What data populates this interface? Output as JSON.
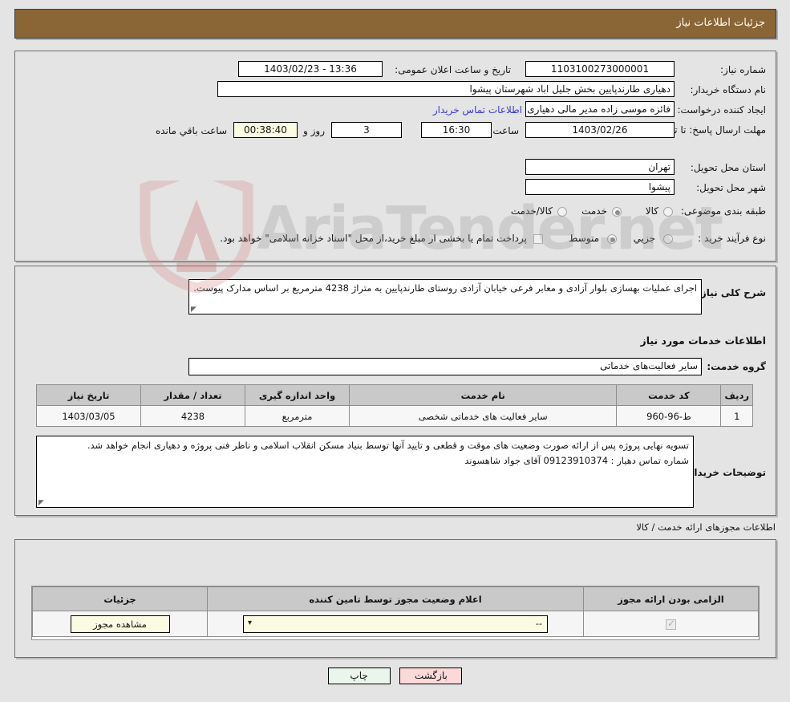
{
  "header": {
    "title": "جزئیات اطلاعات نیاز"
  },
  "form": {
    "need_number_label": "شماره نیاز:",
    "need_number_value": "1103100273000001",
    "announce_datetime_label": "تاریخ و ساعت اعلان عمومی:",
    "announce_datetime_value": "13:36 - 1403/02/23",
    "buyer_org_label": "نام دستگاه خریدار:",
    "buyer_org_value": "دهیاری طارندپایین بخش جلیل اباد شهرستان پیشوا",
    "requester_label": "ایجاد کننده درخواست:",
    "requester_value": "فائزه موسی زاده مدیر مالی دهیاری طارندپایین بخش جلیل اباد شهرستان پیشوا",
    "buyer_contact_link": "اطلاعات تماس خریدار",
    "deadline_label": "مهلت ارسال پاسخ: تا تاریخ:",
    "deadline_date": "1403/02/26",
    "hour_label": "ساعت",
    "deadline_time": "16:30",
    "days_remaining": "3",
    "days_label": "روز و",
    "time_remaining": "00:38:40",
    "remaining_suffix": "ساعت باقي مانده",
    "province_label": "استان محل تحویل:",
    "province_value": "تهران",
    "city_label": "شهر محل تحویل:",
    "city_value": "پیشوا",
    "category_label": "طبقه بندی موضوعی:",
    "category_options": [
      {
        "label": "کالا",
        "selected": false
      },
      {
        "label": "خدمت",
        "selected": true
      },
      {
        "label": "کالا/خدمت",
        "selected": false
      }
    ],
    "process_label": "نوع فرآیند خرید :",
    "process_options": [
      {
        "label": "جزیي",
        "selected": false
      },
      {
        "label": "متوسط",
        "selected": true
      }
    ],
    "treasury_checkbox_label": "پرداخت تمام یا بخشی از مبلغ خرید،از محل \"اسناد خزانه اسلامی\" خواهد بود.",
    "treasury_checked": false
  },
  "description": {
    "general_label": "شرح کلی نیاز:",
    "general_value": "اجرای عملیات بهسازی بلوار آزادی و معابر فرعی خیابان آزادی روستای طارندپایین به متراژ 4238 مترمربع بر اساس مدارک پیوست.",
    "services_heading": "اطلاعات خدمات مورد نیاز",
    "service_group_label": "گروه خدمت:",
    "service_group_value": "سایر فعالیت‌های خدماتی"
  },
  "items_table": {
    "columns": [
      "ردیف",
      "کد خدمت",
      "نام خدمت",
      "واحد اندازه گیری",
      "تعداد / مقدار",
      "تاریخ نیاز"
    ],
    "rows": [
      {
        "row": "1",
        "code": "ط-96-960",
        "name": "سایر فعالیت های خدماتی شخصی",
        "unit": "مترمربع",
        "quantity": "4238",
        "need_date": "1403/03/05"
      }
    ]
  },
  "buyer_notes": {
    "label": "توضیحات خریدار:",
    "line1": "تسویه نهایی پروژه پس از ارائه صورت وضعیت های موقت و قطعی و تایید آنها توسط بنیاد مسکن انقلاب اسلامی و ناظر فنی پروژه و دهیاری انجام خواهد شد.",
    "line2": "شماره تماس دهیار : 09123910374 آقای جواد شاهسوند"
  },
  "permits": {
    "section_label": "اطلاعات مجوزهای ارائه خدمت / کالا",
    "columns": [
      "الزامی بودن ارائه مجوز",
      "اعلام وضعیت مجوز توسط تامین کننده",
      "جزئیات"
    ],
    "rows": [
      {
        "required": true,
        "status": "--",
        "details_button": "مشاهده مجوز"
      }
    ]
  },
  "footer": {
    "print_label": "چاپ",
    "back_label": "بازگشت"
  },
  "watermark": {
    "text": "AriaTender.net"
  },
  "colors": {
    "header_bg": "#8a6535",
    "page_bg": "#e4e4e4",
    "link": "#3a3ad0",
    "highlight_field": "#fbfbe4",
    "print_btn": "#eaf6ea",
    "back_btn": "#fbd9d9"
  }
}
